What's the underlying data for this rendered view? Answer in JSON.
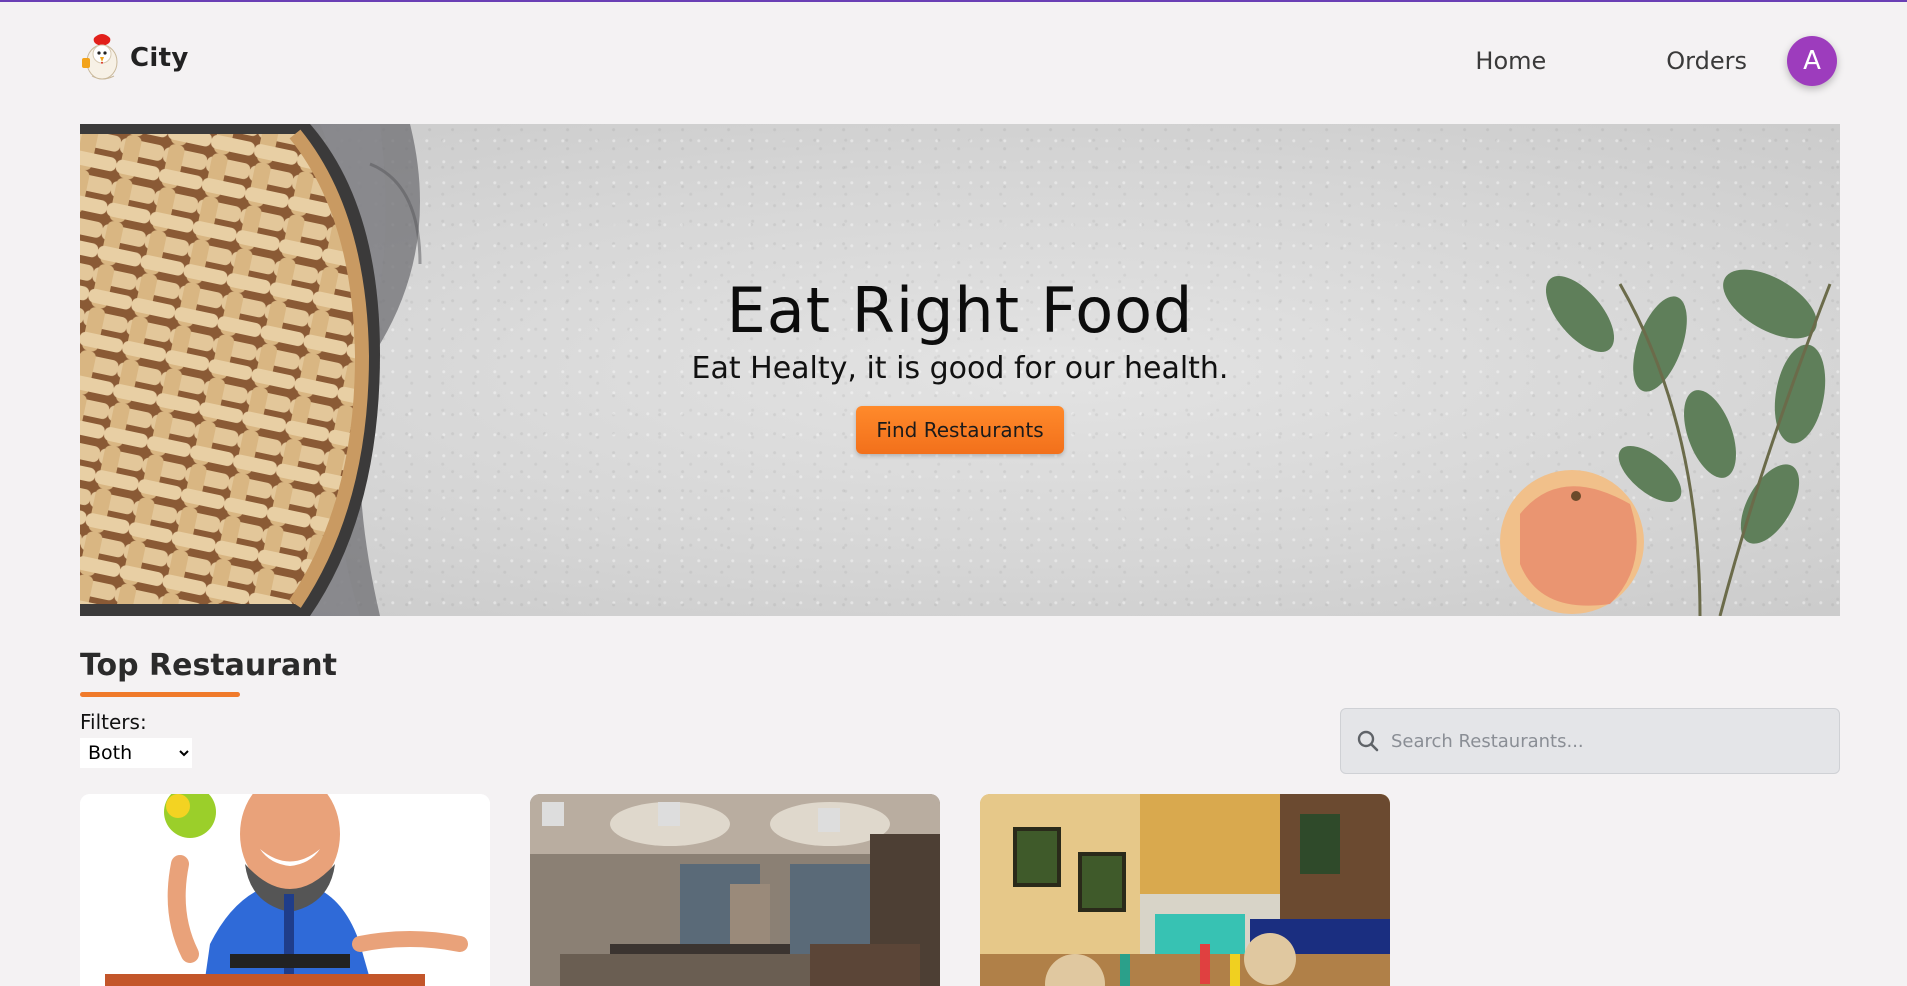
{
  "brand": {
    "name": "City",
    "logo_icon": "chicken-chef-logo"
  },
  "nav": {
    "home_label": "Home",
    "orders_label": "Orders",
    "avatar_initial": "A"
  },
  "hero": {
    "title": "Eat Right Food",
    "subtitle": "Eat Healty, it is good for our health.",
    "button_label": "Find Restaurants"
  },
  "section": {
    "title": "Top Restaurant"
  },
  "filters": {
    "label": "Filters:",
    "selected": "Both"
  },
  "search": {
    "placeholder": "Search Restaurants...",
    "value": "",
    "icon": "search-icon"
  },
  "restaurants": [
    {
      "image": "chef-cartoon-image"
    },
    {
      "image": "restaurant-interior-image"
    },
    {
      "image": "cafe-interior-image"
    }
  ],
  "colors": {
    "accent": "#f07a2a",
    "avatar": "#9d3cbd",
    "background": "#f4f2f3",
    "top_border": "#6a3fb5"
  }
}
